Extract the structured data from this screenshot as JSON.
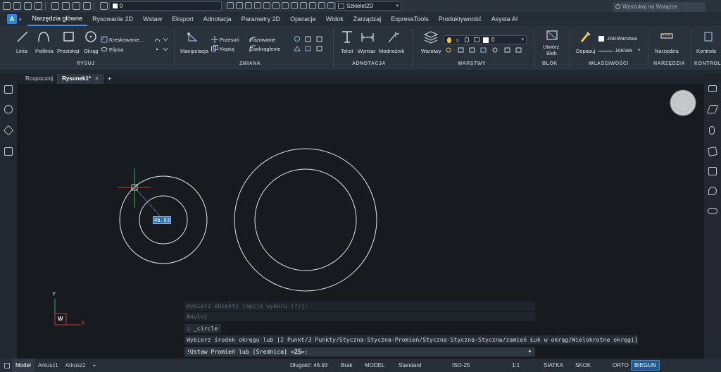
{
  "quick_access": {
    "layer_name": "0",
    "workspace": "Szkielet2D"
  },
  "ribbon_tabs": [
    "Narzędzia główne",
    "Rysowanie 2D",
    "Wstaw",
    "Eksport",
    "Adnotacja",
    "Parametry 2D",
    "Operacje",
    "Widok",
    "Zarządzaj",
    "ExpressTools",
    "Produktywność",
    "Asysta AI"
  ],
  "search": {
    "placeholder": "Wyszukaj na Wstążce"
  },
  "ribbon": {
    "draw": {
      "title": "RYSUJ",
      "line": "Linia",
      "polyline": "Polilinia",
      "rectangle": "Prostokąt",
      "circle": "Okrąg",
      "hatch": "Kreskowanie...",
      "ellipse": "Elipsa"
    },
    "modify": {
      "title": "ZMIANA",
      "manipulation": "Manipulacja",
      "move": "Przesuń",
      "copy": "Kopiuj",
      "chamfer": "Fazowanie",
      "fillet": "Zaokrąglenie"
    },
    "annotation": {
      "title": "ADNOTACJA",
      "text": "Tekst",
      "dimension": "Wymiar",
      "leader": "Modnośnik"
    },
    "layers": {
      "title": "WARSTWY",
      "layers": "Warstwy",
      "current_layer": "0"
    },
    "block": {
      "title": "BLOK",
      "create_line1": "Utwórz",
      "create_line2": "Blok"
    },
    "properties": {
      "title": "WŁAŚCIWOŚCI",
      "match": "Dopasuj",
      "color": "JAKWarstwa",
      "linetype": "JAKWa"
    },
    "tools": {
      "title": "NARZĘDZIA",
      "tools": "Narzędzia"
    },
    "control": {
      "title": "KONTROLA",
      "control": "Kontrola"
    }
  },
  "doc_tabs": {
    "start": "Rozpocznij",
    "drawing": "Rysunek1*",
    "close": "×",
    "add": "+"
  },
  "canvas": {
    "dynamic_input": "46.93",
    "ucs_x": "X",
    "ucs_y": "Y",
    "ucs_w": "W"
  },
  "command_history": [
    "Wybierz obiekty [opcje wyboru (?)]:",
    "Anuluj",
    ": _circle",
    "Wybierz środek okręgu lub [2 Punkt/3 Punkty/Styczna-Styczna-Promień/Styczna-Styczna-Styczna/zamień Łuk w okrąg/Wielokrotne okręgi]:"
  ],
  "command_input": {
    "prefix": "!Ustaw Promień lub [Średnica] <",
    "default": "25",
    "suffix": ">:"
  },
  "status_bar": {
    "layout_tabs": [
      "Model",
      "Arkusz1",
      "Arkusz2"
    ],
    "add": "+",
    "length_label": "Długość: 46.93",
    "brak": "Brak",
    "model": "MODEL",
    "style": "Standard",
    "dimstyle": "ISO-25",
    "scale": "1:1",
    "grid": "SIATKA",
    "snap": "SKOK",
    "ortho": "ORTO",
    "polar": "BIEGUN"
  },
  "colors": {
    "accent": "#3b93e3",
    "canvas": "#171a1f",
    "ribbon": "#2a323b",
    "ucs_x": "#d23b3b",
    "ucs_y": "#35b34f"
  }
}
